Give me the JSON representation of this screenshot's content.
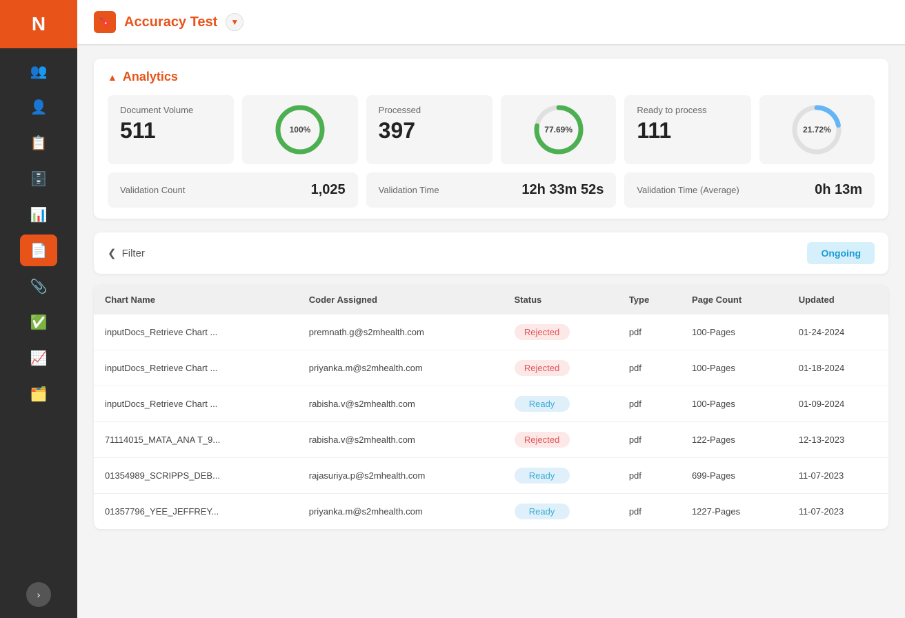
{
  "sidebar": {
    "logo": "N",
    "items": [
      {
        "id": "team",
        "icon": "👥",
        "active": false
      },
      {
        "id": "person",
        "icon": "👤",
        "active": false
      },
      {
        "id": "list",
        "icon": "📋",
        "active": false
      },
      {
        "id": "database",
        "icon": "🗄️",
        "active": false
      },
      {
        "id": "chart",
        "icon": "📊",
        "active": false
      },
      {
        "id": "document",
        "icon": "📄",
        "active": true
      },
      {
        "id": "clipboard",
        "icon": "📎",
        "active": false
      },
      {
        "id": "checklist",
        "icon": "✅",
        "active": false
      },
      {
        "id": "bar-chart",
        "icon": "📈",
        "active": false
      },
      {
        "id": "table",
        "icon": "🗂️",
        "active": false
      }
    ],
    "toggle_icon": "›"
  },
  "header": {
    "icon": "🔖",
    "title": "Accuracy Test",
    "chevron": "▼"
  },
  "analytics": {
    "section_title": "Analytics",
    "cards": [
      {
        "label": "Document Volume",
        "value": "511",
        "has_chart": false
      },
      {
        "chart_value": "100%",
        "chart_pct": 100,
        "chart_color": "#4caf50",
        "chart_bg": "#e0e0e0"
      },
      {
        "label": "Processed",
        "value": "397",
        "has_chart": false
      },
      {
        "chart_value": "77.69%",
        "chart_pct": 77.69,
        "chart_color": "#4caf50",
        "chart_bg": "#e0e0e0"
      },
      {
        "label": "Ready to process",
        "value": "111",
        "has_chart": false
      },
      {
        "chart_value": "21.72%",
        "chart_pct": 21.72,
        "chart_color": "#64b5f6",
        "chart_bg": "#e0e0e0"
      }
    ],
    "stats": [
      {
        "label": "Validation Count",
        "value": "1,025"
      },
      {
        "label": "Validation Time",
        "value": "12h 33m 52s"
      },
      {
        "label": "Validation Time (Average)",
        "value": "0h 13m"
      }
    ]
  },
  "filter": {
    "label": "Filter",
    "chevron": "❯",
    "ongoing_btn": "Ongoing"
  },
  "table": {
    "columns": [
      "Chart Name",
      "Coder Assigned",
      "Status",
      "Type",
      "Page Count",
      "Updated"
    ],
    "rows": [
      {
        "chart_name": "inputDocs_Retrieve Chart ...",
        "coder": "premnath.g@s2mhealth.com",
        "status": "Rejected",
        "status_type": "rejected",
        "type": "pdf",
        "page_count": "100-Pages",
        "updated": "01-24-2024"
      },
      {
        "chart_name": "inputDocs_Retrieve Chart ...",
        "coder": "priyanka.m@s2mhealth.com",
        "status": "Rejected",
        "status_type": "rejected",
        "type": "pdf",
        "page_count": "100-Pages",
        "updated": "01-18-2024"
      },
      {
        "chart_name": "inputDocs_Retrieve Chart ...",
        "coder": "rabisha.v@s2mhealth.com",
        "status": "Ready",
        "status_type": "ready",
        "type": "pdf",
        "page_count": "100-Pages",
        "updated": "01-09-2024"
      },
      {
        "chart_name": "71114015_MATA_ANA T_9...",
        "coder": "rabisha.v@s2mhealth.com",
        "status": "Rejected",
        "status_type": "rejected",
        "type": "pdf",
        "page_count": "122-Pages",
        "updated": "12-13-2023"
      },
      {
        "chart_name": "01354989_SCRIPPS_DEB...",
        "coder": "rajasuriya.p@s2mhealth.com",
        "status": "Ready",
        "status_type": "ready",
        "type": "pdf",
        "page_count": "699-Pages",
        "updated": "11-07-2023"
      },
      {
        "chart_name": "01357796_YEE_JEFFREY...",
        "coder": "priyanka.m@s2mhealth.com",
        "status": "Ready",
        "status_type": "ready",
        "type": "pdf",
        "page_count": "1227-Pages",
        "updated": "11-07-2023"
      }
    ]
  }
}
